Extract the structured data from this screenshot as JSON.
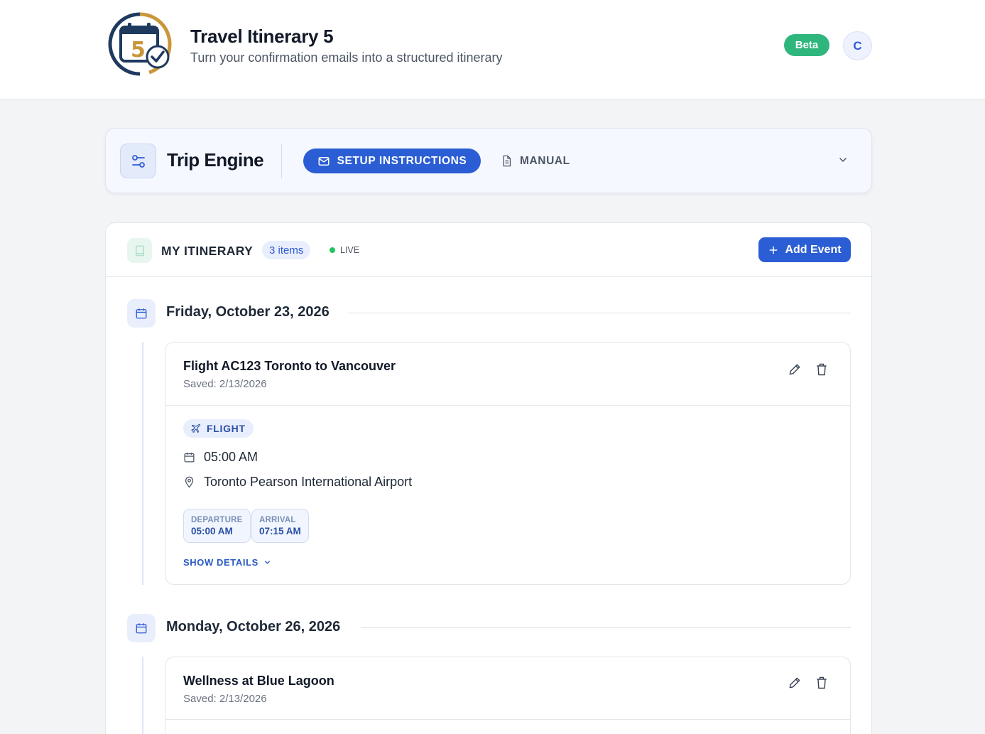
{
  "header": {
    "title": "Travel Itinerary 5",
    "subtitle": "Turn your confirmation emails into a structured itinerary",
    "logo_number": "5",
    "beta": "Beta",
    "avatar_initial": "C"
  },
  "engine": {
    "title": "Trip Engine",
    "setup_label": "SETUP INSTRUCTIONS",
    "manual_label": "MANUAL"
  },
  "itinerary": {
    "title": "MY ITINERARY",
    "count": "3 items",
    "live": "LIVE",
    "add_label": "Add Event",
    "days": [
      {
        "date": "Friday, October 23, 2026",
        "events": [
          {
            "title": "Flight AC123 Toronto to Vancouver",
            "saved": "Saved: 2/13/2026",
            "type": "FLIGHT",
            "time": "05:00 AM",
            "location": "Toronto Pearson International Airport",
            "departure_label": "DEPARTURE",
            "departure": "05:00 AM",
            "arrival_label": "ARRIVAL",
            "arrival": "07:15 AM",
            "details_label": "SHOW DETAILS"
          }
        ]
      },
      {
        "date": "Monday, October 26, 2026",
        "events": [
          {
            "title": "Wellness at Blue Lagoon",
            "saved": "Saved: 2/13/2026"
          }
        ]
      }
    ]
  },
  "colors": {
    "primary": "#2b5ed4",
    "beta": "#2fb67c",
    "live": "#22c55e",
    "logo_navy": "#1f3a5f",
    "logo_gold": "#c9973a"
  }
}
